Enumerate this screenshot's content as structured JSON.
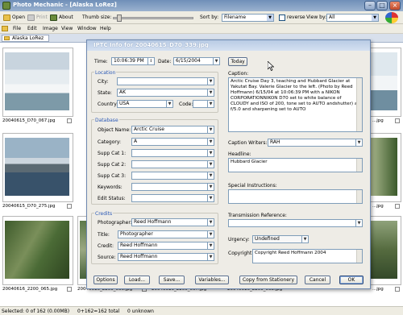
{
  "window": {
    "title": "Photo Mechanic - [Alaska LoRez]"
  },
  "toolbar": {
    "open_label": "Open",
    "print_label": "Print",
    "about_label": "About",
    "thumb_size_label": "Thumb size:",
    "sort_by_label": "Sort by:",
    "sort_by_value": "Filename",
    "reverse_label": "reverse",
    "view_by_label": "View by:",
    "view_by_value": "All"
  },
  "menu": [
    "File",
    "Edit",
    "Image",
    "View",
    "Window",
    "Help"
  ],
  "breadcrumb": {
    "folder": "Alaska LoRez"
  },
  "thumbnails": [
    {
      "caption": "20040615_D70_067.jpg"
    },
    {
      "caption": "...jpg"
    },
    {
      "caption": "20040615_D70_275.jpg"
    },
    {
      "caption": "...jpg"
    },
    {
      "caption": "20040616_2200_065.jpg"
    },
    {
      "caption": "20040616_2200_066.jpg"
    },
    {
      "caption": "20040616_2200_067.jpg"
    },
    {
      "caption": "20040616_2200_068.jpg"
    },
    {
      "caption": "...jpg"
    }
  ],
  "status": {
    "selected": "Selected: 0 of 162 (0.00MB)",
    "total": "0+162=162 total",
    "unknown": "0 unknown"
  },
  "dialog": {
    "title": "IPTC Info for 20040615_D70_339.jpg",
    "time_label": "Time:",
    "time_value": "10:06:39 PM",
    "date_label": "Date:",
    "date_value": "6/15/2004",
    "today_button": "Today",
    "location_section": "Location",
    "city_label": "City:",
    "city_value": "",
    "state_label": "State:",
    "state_value": "AK",
    "country_label": "Country:",
    "country_value": "USA",
    "code_label": "Code:",
    "code_value": "",
    "database_section": "Database",
    "object_name_label": "Object Name:",
    "object_name_value": "Arctic Cruise",
    "category_label": "Category:",
    "category_value": "A",
    "supp1_label": "Supp Cat 1:",
    "supp2_label": "Supp Cat 2:",
    "supp3_label": "Supp Cat 3:",
    "keywords_label": "Keywords:",
    "edit_status_label": "Edit Status:",
    "credits_section": "Credits",
    "photographer_label": "Photographer:",
    "photographer_value": "Reed Hoffmann",
    "title_label": "Title:",
    "title_value": "Photographer",
    "credit_label": "Credit:",
    "credit_value": "Reed Hoffmann",
    "source_label": "Source:",
    "source_value": "Reed Hoffmann",
    "caption_label": "Caption:",
    "caption_value": "Arctic Cruise Day 3, teaching and Hubbard Glacier at Yakutat Bay. Valerie Glacier to the left. (Photo by Reed Hoffmann) 6/15/04 at 10:06:39 PM with a NIKON CORPORATIONNIKON D70 set to white balance of CLOUDY and ISO of 200, tone set to AUTO andshutter) at f/5.0 and sharpening set to AUTO",
    "caption_writers_label": "Caption Writers:",
    "caption_writers_value": "RAH",
    "headline_label": "Headline:",
    "headline_value": "Hubbard Glacier",
    "special_instructions_label": "Special Instructions:",
    "transmission_label": "Transmission Reference:",
    "urgency_label": "Urgency:",
    "urgency_value": "Undefined",
    "copyright_label": "Copyright:",
    "copyright_value": "Copyright Reed Hoffmann 2004",
    "buttons": {
      "options": "Options",
      "load": "Load...",
      "save": "Save...",
      "variables": "Variables...",
      "copy": "Copy from Stationery",
      "cancel": "Cancel",
      "ok": "OK"
    }
  },
  "colors": {
    "accent": "#2b59b5",
    "titlebar": "#6f8fb8",
    "background": "#ffffff"
  }
}
